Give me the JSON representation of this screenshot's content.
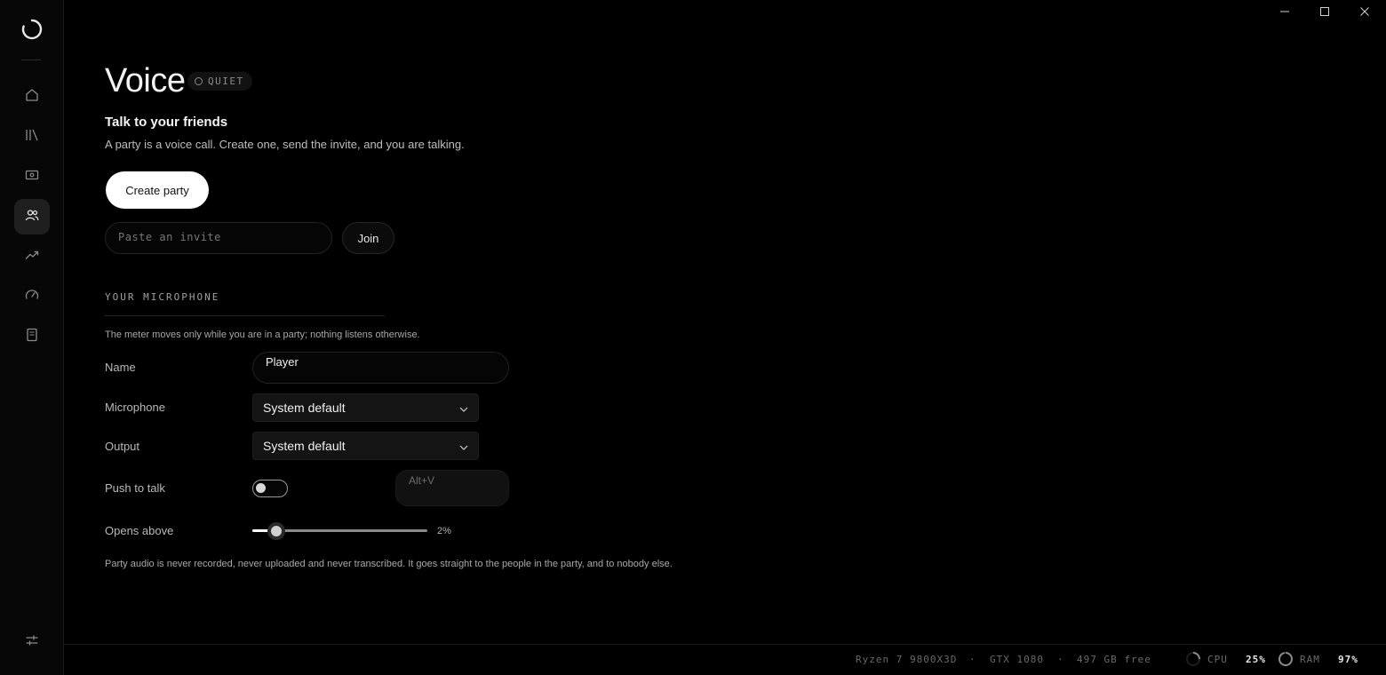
{
  "sidebar": {
    "logo": "app-logo",
    "items": [
      {
        "icon": "home-icon",
        "active": false
      },
      {
        "icon": "library-icon",
        "active": false
      },
      {
        "icon": "screen-icon",
        "active": false
      },
      {
        "icon": "people-icon",
        "active": true
      },
      {
        "icon": "trending-icon",
        "active": false
      },
      {
        "icon": "gauge-icon",
        "active": false
      },
      {
        "icon": "document-icon",
        "active": false
      }
    ],
    "bottom_icon": "sliders-icon"
  },
  "window": {
    "controls": [
      "minimize-icon",
      "maximize-icon",
      "close-icon"
    ]
  },
  "header": {
    "title": "Voice",
    "badge": "QUIET"
  },
  "party": {
    "heading": "Talk to your friends",
    "description": "A party is a voice call. Create one, send the invite, and you are talking.",
    "create_label": "Create party",
    "invite_placeholder": "Paste an invite",
    "join_label": "Join"
  },
  "microphone": {
    "section_label": "YOUR MICROPHONE",
    "note": "The meter moves only while you are in a party; nothing listens otherwise.",
    "name_label": "Name",
    "name_value": "Player",
    "mic_label": "Microphone",
    "mic_value": "System default",
    "output_label": "Output",
    "output_value": "System default",
    "ptt_label": "Push to talk",
    "ptt_enabled": false,
    "ptt_hotkey": "Alt+V",
    "threshold_label": "Opens above",
    "threshold_value": "2%",
    "threshold_percent": 2,
    "privacy": "Party audio is never recorded, never uploaded and never transcribed. It goes straight to the people in the party, and to nobody else."
  },
  "status": {
    "cpu_model": "Ryzen 7 9800X3D",
    "sep1": "·",
    "gpu_model": "GTX 1080",
    "sep2": "·",
    "disk": "497 GB free",
    "cpu_label": "CPU",
    "cpu_value": "25%",
    "cpu_percent": 25,
    "ram_label": "RAM",
    "ram_value": "97%",
    "ram_percent": 97
  },
  "colors": {
    "background": "#000000",
    "accent": "#ffffff",
    "sidebar": "#070707"
  }
}
